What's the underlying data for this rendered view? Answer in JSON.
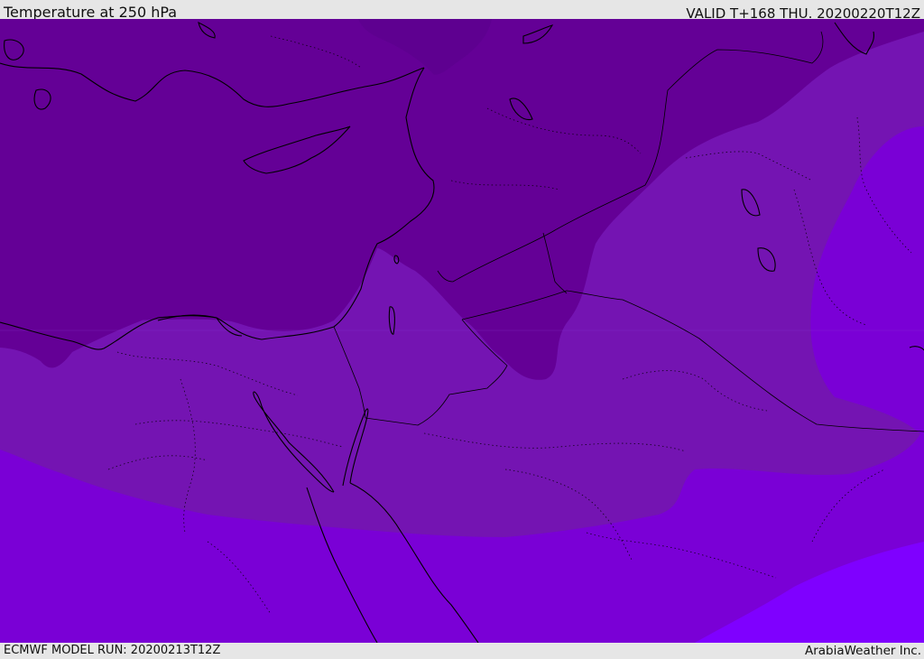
{
  "header": {
    "title": "Temperature at 250 hPa",
    "valid": "VALID T+168 THU. 20200220T12Z"
  },
  "footer": {
    "model_run": "ECMWF MODEL RUN: 20200213T12Z",
    "credit": "ArabiaWeather Inc."
  },
  "colors": {
    "band_coldest": "#5e0090",
    "band_cold": "#640096",
    "band_mid": "#7414b2",
    "band_warm": "#7a00d6",
    "band_warmest": "#7f00ff",
    "coastline": "#000000",
    "frame": "#e6e6e6"
  }
}
